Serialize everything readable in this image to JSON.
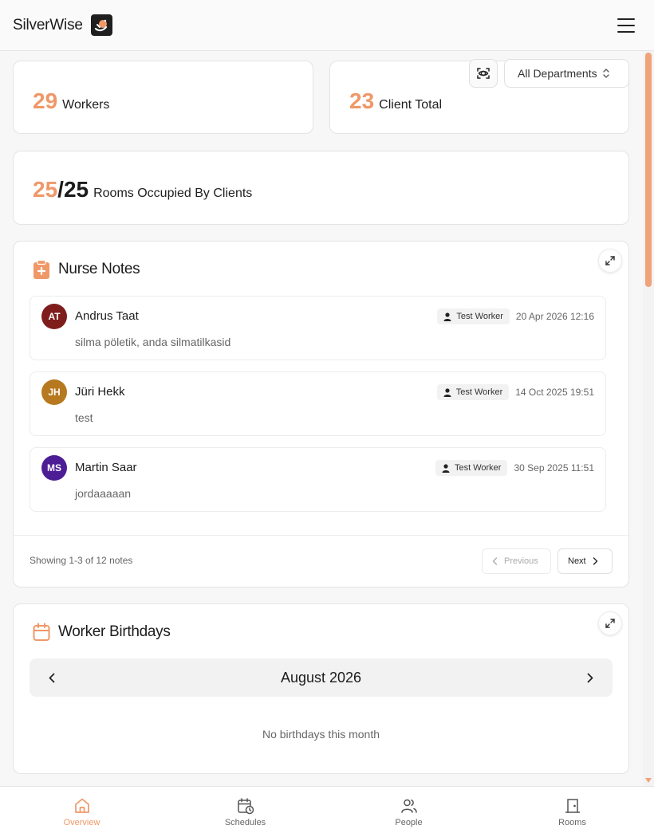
{
  "app": {
    "name": "SilverWise"
  },
  "colors": {
    "accent": "#ef9868",
    "accent_dark": "#e07a45"
  },
  "stats": {
    "workers": {
      "value": "29",
      "label": "Workers"
    },
    "clients": {
      "value": "23",
      "label": "Client Total"
    },
    "rooms": {
      "occupied": "25",
      "separator": "/",
      "total": "25",
      "label": "Rooms Occupied By Clients"
    }
  },
  "filter": {
    "department": "All Departments"
  },
  "nurse_notes": {
    "title": "Nurse Notes",
    "notes": [
      {
        "initials": "AT",
        "name": "Andrus Taat",
        "text": "silma pöletik, anda silmatilkasid",
        "worker": "Test Worker",
        "date": "20 Apr 2026 12:16",
        "avatar_color": "#7f1d1d"
      },
      {
        "initials": "JH",
        "name": "Jüri Hekk",
        "text": "test",
        "worker": "Test Worker",
        "date": "14 Oct 2025 19:51",
        "avatar_color": "#b7791f"
      },
      {
        "initials": "MS",
        "name": "Martin Saar",
        "text": "jordaaaaan",
        "worker": "Test Worker",
        "date": "30 Sep 2025 11:51",
        "avatar_color": "#4c1d95"
      }
    ],
    "showing": "Showing 1-3 of 12 notes",
    "previous_label": "Previous",
    "next_label": "Next"
  },
  "birthdays": {
    "title": "Worker Birthdays",
    "month": "August 2026",
    "empty": "No birthdays this month"
  },
  "nav": [
    {
      "label": "Overview",
      "icon": "home-icon",
      "active": true
    },
    {
      "label": "Schedules",
      "icon": "calendar-clock-icon",
      "active": false
    },
    {
      "label": "People",
      "icon": "people-icon",
      "active": false
    },
    {
      "label": "Rooms",
      "icon": "door-icon",
      "active": false
    }
  ]
}
